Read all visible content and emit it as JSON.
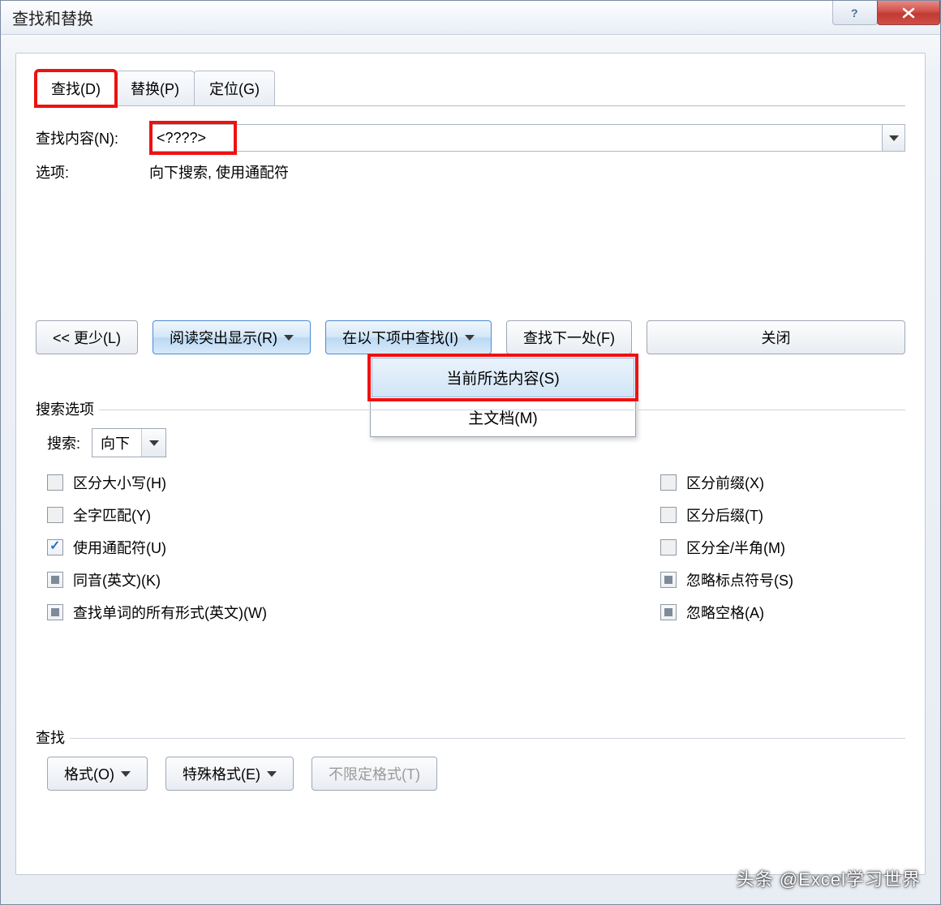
{
  "window": {
    "title": "查找和替换"
  },
  "tabs": {
    "find": "查找(D)",
    "replace": "替换(P)",
    "goto": "定位(G)"
  },
  "find": {
    "content_label": "查找内容(N):",
    "content_value": "<????>",
    "options_label": "选项:",
    "options_text": "向下搜索, 使用通配符"
  },
  "buttons": {
    "less": "<< 更少(L)",
    "highlight": "阅读突出显示(R)",
    "find_in": "在以下项中查找(I)",
    "find_next": "查找下一处(F)",
    "close": "关闭"
  },
  "menu": {
    "selection": "当前所选内容(S)",
    "main_doc": "主文档(M)"
  },
  "search_options": {
    "legend": "搜索选项",
    "search_label": "搜索:",
    "direction": "向下",
    "left": {
      "match_case": "区分大小写(H)",
      "whole_word": "全字匹配(Y)",
      "wildcards": "使用通配符(U)",
      "sounds_like": "同音(英文)(K)",
      "all_forms": "查找单词的所有形式(英文)(W)"
    },
    "right": {
      "prefix": "区分前缀(X)",
      "suffix": "区分后缀(T)",
      "full_half": "区分全/半角(M)",
      "ignore_punct": "忽略标点符号(S)",
      "ignore_space": "忽略空格(A)"
    }
  },
  "find_section": {
    "legend": "查找",
    "format": "格式(O)",
    "special": "特殊格式(E)",
    "no_format": "不限定格式(T)"
  },
  "watermark": "头条 @Excel学习世界"
}
